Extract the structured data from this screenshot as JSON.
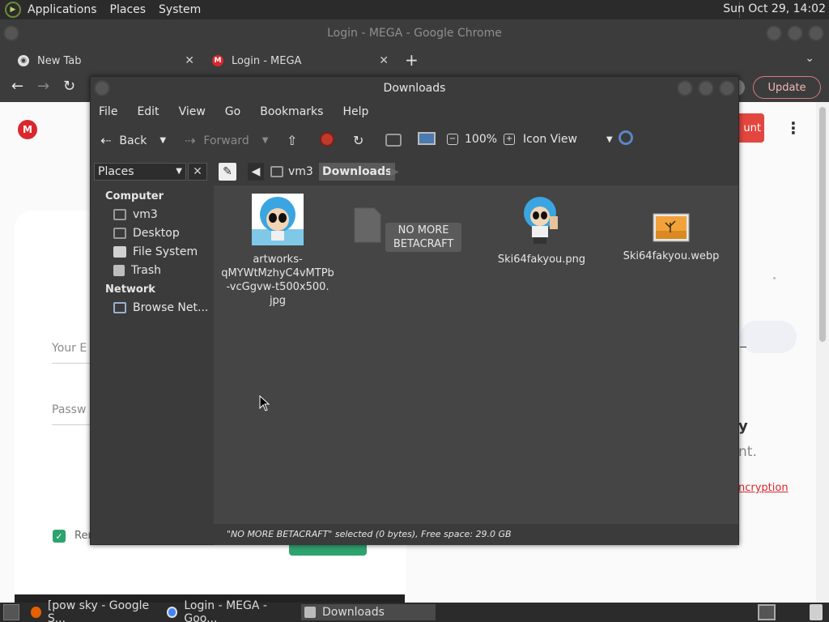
{
  "top_panel": {
    "menus": [
      "Applications",
      "Places",
      "System"
    ],
    "clock": "Sun Oct 29, 14:02"
  },
  "chrome": {
    "window_title": "Login - MEGA - Google Chrome",
    "tabs": [
      {
        "label": "New Tab",
        "icon": "chrome-icon"
      },
      {
        "label": "Login - MEGA",
        "icon": "mega-icon"
      }
    ],
    "new_tab_symbol": "+",
    "update_label": "Update"
  },
  "mega_page": {
    "logo_letter": "M",
    "email_placeholder": "Your E",
    "password_placeholder": "Passw",
    "remember_label": "Rer",
    "create_account_partial": "unt",
    "side_heading_partial": "y",
    "side_text_partial": "nt.",
    "side_link_partial": "ncryption"
  },
  "file_manager": {
    "window_title": "Downloads",
    "menu": [
      "File",
      "Edit",
      "View",
      "Go",
      "Bookmarks",
      "Help"
    ],
    "toolbar": {
      "back": "Back",
      "forward": "Forward",
      "zoom": "100%",
      "view_mode": "Icon View"
    },
    "sidebar": {
      "selector": "Places",
      "computer_heading": "Computer",
      "computer_items": [
        "vm3",
        "Desktop",
        "File System",
        "Trash"
      ],
      "network_heading": "Network",
      "network_items": [
        "Browse Net..."
      ]
    },
    "path": [
      "vm3",
      "Downloads"
    ],
    "files": [
      {
        "name": "artworks-qMYWtMzhyC4vMTPb-vcGgvw-t500x500.jpg",
        "lines": [
          "artworks-",
          "qMYWtMzhyC4vMTPb",
          "-vcGgvw-t500x500.",
          "jpg"
        ],
        "type": "image"
      },
      {
        "name": "NO MORE BETACRAFT",
        "lines": [
          "NO MORE",
          "BETACRAFT"
        ],
        "type": "empty-file",
        "selected": true
      },
      {
        "name": "Ski64fakyou.png",
        "lines": [
          "Ski64fakyou.png"
        ],
        "type": "image"
      },
      {
        "name": "Ski64fakyou.webp",
        "lines": [
          "Ski64fakyou.webp"
        ],
        "type": "image-placeholder"
      }
    ],
    "status": "\"NO MORE BETACRAFT\" selected (0 bytes), Free space: 29.0 GB"
  },
  "taskbar": {
    "tasks": [
      {
        "label": "[pow sky - Google S..."
      },
      {
        "label": "Login - MEGA - Goo..."
      },
      {
        "label": "Downloads"
      }
    ]
  },
  "colors": {
    "mega_red": "#d9272e",
    "mega_green": "#2fa36f",
    "fm_background": "#454545"
  }
}
